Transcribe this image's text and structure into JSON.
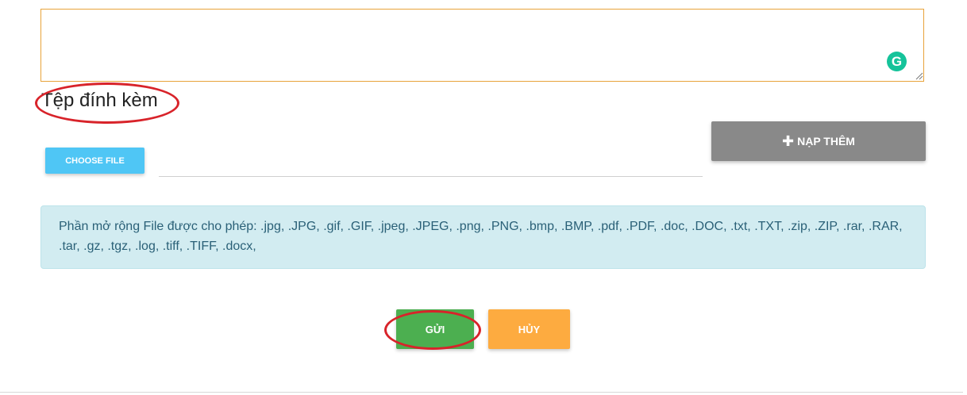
{
  "message": {
    "value": ""
  },
  "grammarly": {
    "icon": "grammarly-icon",
    "letter": "G",
    "color": "#15c39a"
  },
  "attachments": {
    "title": "Tệp đính kèm",
    "choose_file_label": "CHOOSE FILE",
    "file_path_value": "",
    "add_more_label": "NẠP THÊM",
    "add_more_icon": "plus-icon"
  },
  "allowed_extensions_text": "Phần mở rộng File được cho phép: .jpg, .JPG, .gif, .GIF, .jpeg, .JPEG, .png, .PNG, .bmp, .BMP, .pdf, .PDF, .doc, .DOC, .txt, .TXT, .zip, .ZIP, .rar, .RAR, .tar, .gz, .tgz, .log, .tiff, .TIFF, .docx,",
  "actions": {
    "submit_label": "GỬI",
    "cancel_label": "HỦY"
  },
  "colors": {
    "choose_file": "#4fc6f5",
    "add_more": "#898989",
    "submit": "#4caf50",
    "cancel": "#fdab40",
    "info_bg": "#d2ecf1",
    "annotation": "#d8232a"
  }
}
